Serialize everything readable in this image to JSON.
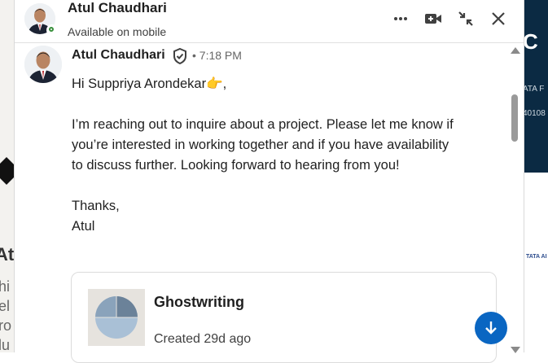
{
  "background": {
    "left_text": "At",
    "left_lines": [
      "hi",
      "el",
      "ro",
      "lu"
    ],
    "right_banner_big": "C",
    "right_banner_line1": "ATA F",
    "right_banner_line2": "40108",
    "right_logo": "TATA AI"
  },
  "header": {
    "name": "Atul Chaudhari",
    "status": "Available on mobile",
    "actions": [
      "more-options",
      "video-call",
      "minimize",
      "close"
    ]
  },
  "message": {
    "sender": "Atul Chaudhari",
    "separator": "•",
    "time": "7:18 PM",
    "greeting": "Hi Suppriya Arondekar👉,",
    "paragraph": "I’m reaching out to inquire about a project. Please let me know if you’re interested in working together and if you have availability to discuss further. Looking forward to hearing from you!",
    "closing": "Thanks,",
    "signature": "Atul"
  },
  "card": {
    "title": "Ghostwriting",
    "subtitle": "Created 29d ago"
  },
  "colors": {
    "accent": "#0a66c2",
    "presence": "#378f3b"
  }
}
